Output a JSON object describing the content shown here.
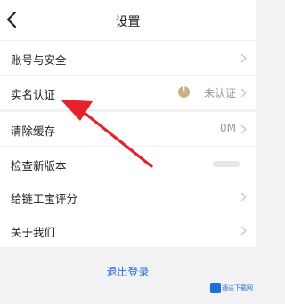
{
  "header": {
    "title": "设置"
  },
  "rows": [
    {
      "label": "账号与安全",
      "value": ""
    },
    {
      "label": "实名认证",
      "value": "未认证"
    },
    {
      "label": "清除缓存",
      "value": "0M"
    },
    {
      "label": "检查新版本",
      "value": ""
    },
    {
      "label": "给链工宝评分",
      "value": ""
    },
    {
      "label": "关于我们",
      "value": ""
    }
  ],
  "logout_label": "退出登录",
  "watermark": {
    "text": "通达下载网"
  },
  "colors": {
    "background": "#f2f2f4",
    "row_background": "#ffffff",
    "logout_text": "#2f6fe6",
    "annotation_arrow": "#e8202a",
    "warn_badge": "#c8b27e"
  },
  "icons": {
    "back": "chevron-left-icon",
    "row_chevron": "chevron-right-icon",
    "unverified": "exclamation-circle-icon"
  }
}
